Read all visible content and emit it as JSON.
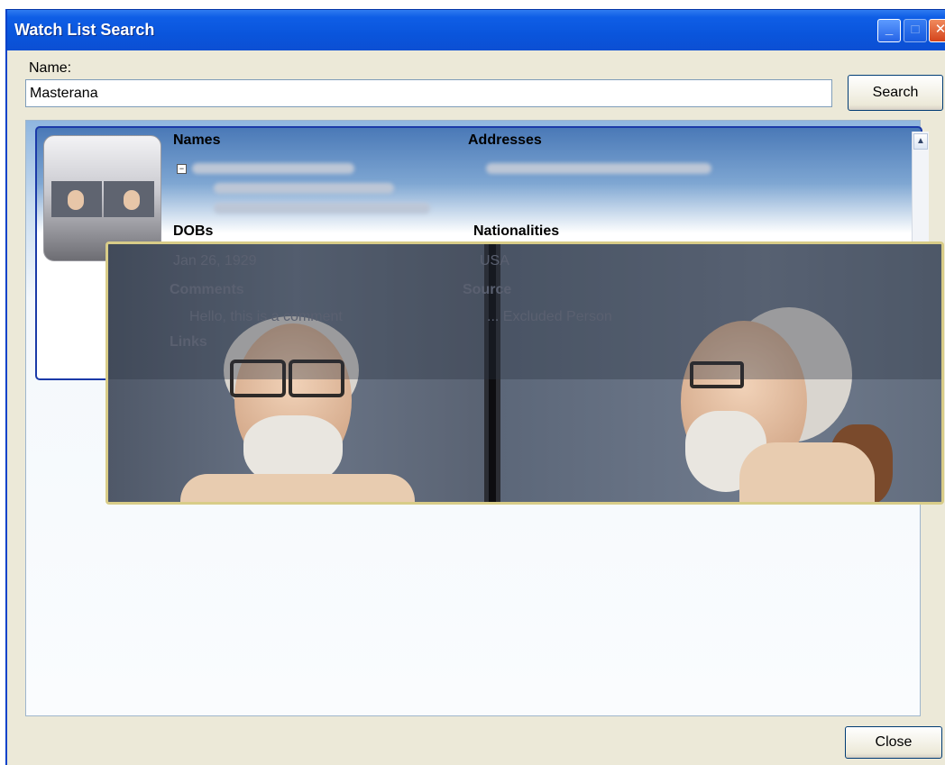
{
  "window": {
    "title": "Watch List Search"
  },
  "search": {
    "name_label": "Name:",
    "name_value": "Masterana",
    "search_button": "Search"
  },
  "result": {
    "sections": {
      "names": "Names",
      "addresses": "Addresses",
      "dobs": "DOBs",
      "nationalities": "Nationalities",
      "comments": "Comments",
      "source": "Source",
      "links": "Links"
    },
    "dob_value": "Jan 26, 1929",
    "nationality_value": "USA",
    "comment_value": "Hello, this is a comment",
    "source_value": "... Excluded Person"
  },
  "footer": {
    "close_button": "Close"
  },
  "icons": {
    "minimize": "minimize-icon",
    "maximize": "maximize-icon",
    "close": "close-icon",
    "collapse": "collapse-icon",
    "scroll_up": "chevron-up-icon"
  },
  "colors": {
    "titlebar": "#0a55dc",
    "card_border": "#1b3aa8",
    "popup_border": "#d8cc88"
  }
}
